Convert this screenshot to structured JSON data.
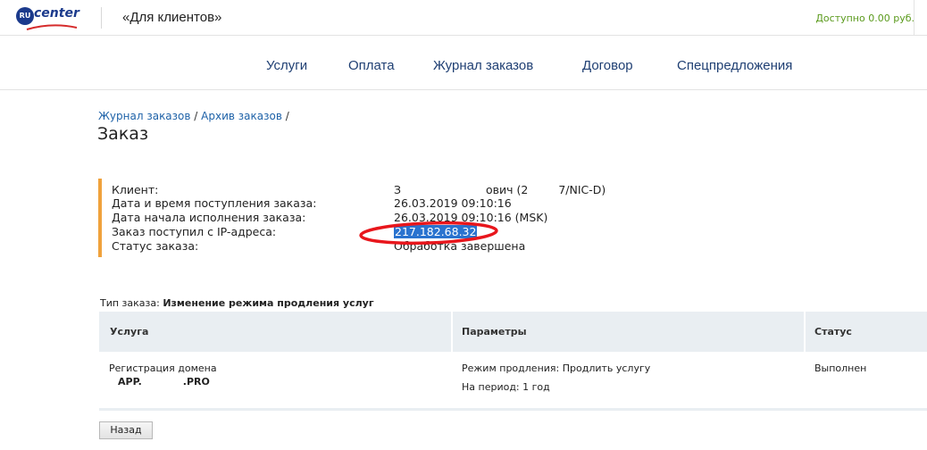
{
  "header": {
    "logo_text": "center",
    "logo_badge": "RU",
    "client_title": "«Для клиентов»",
    "balance": "Доступно 0.00 руб."
  },
  "nav": {
    "items": [
      {
        "label": "Услуги"
      },
      {
        "label": "Оплата"
      },
      {
        "label": "Журнал заказов"
      },
      {
        "label": "Договор"
      },
      {
        "label": "Спецпредложения"
      }
    ]
  },
  "breadcrumb": {
    "items": [
      {
        "label": "Журнал заказов"
      },
      {
        "label": "Архив заказов"
      }
    ],
    "separator": "/"
  },
  "page": {
    "title": "Заказ"
  },
  "order_info": {
    "rows": [
      {
        "label": "Клиент:",
        "value_start": "З",
        "value_mid": "ович (2",
        "value_end": "7/NIC-D)"
      },
      {
        "label": "Дата и время поступления заказа:",
        "value": "26.03.2019 09:10:16"
      },
      {
        "label": "Дата начала исполнения заказа:",
        "value": "26.03.2019 09:10:16 (MSK)"
      },
      {
        "label": "Заказ поступил с IP-адреса:",
        "value": "217.182.68.32"
      },
      {
        "label": "Статус заказа:",
        "value": "Обработка завершена"
      }
    ]
  },
  "order_type": {
    "label": "Тип заказа:",
    "value": "Изменение режима продления услуг"
  },
  "table": {
    "headers": [
      "Услуга",
      "Параметры",
      "Статус"
    ],
    "row": {
      "service_name": "Регистрация домена",
      "domain_start": "APP.",
      "domain_end": ".PRO",
      "param_mode": "Режим продления: Продлить услугу",
      "param_period": "На период: 1 год",
      "status": "Выполнен"
    }
  },
  "actions": {
    "back_label": "Назад"
  },
  "colors": {
    "accent_bar": "#f0a23c",
    "link": "#1e62a8",
    "nav": "#1f3f73",
    "balance": "#5a9a1c",
    "ip_highlight": "#2a73cf",
    "annotation_ellipse": "#e8161c",
    "table_header_bg": "#e9eef2"
  }
}
